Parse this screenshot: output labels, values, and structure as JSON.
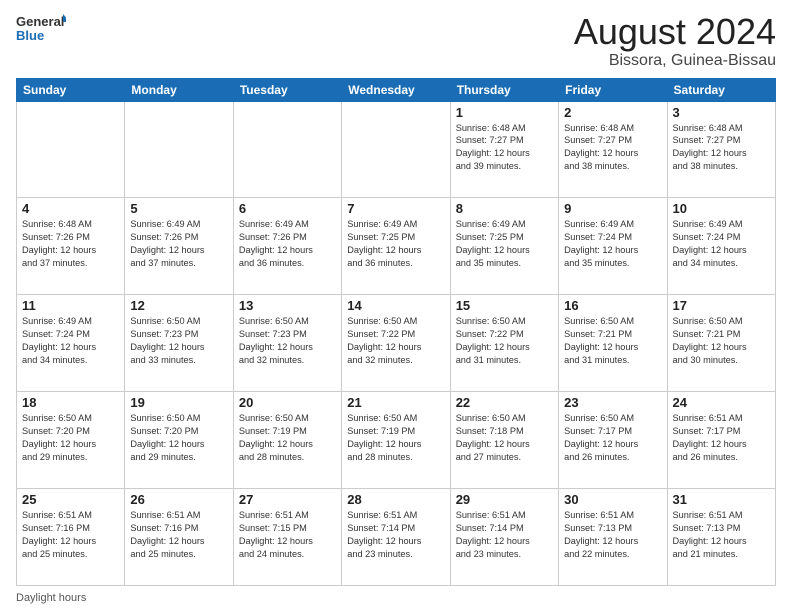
{
  "header": {
    "logo_general": "General",
    "logo_blue": "Blue",
    "title": "August 2024",
    "subtitle": "Bissora, Guinea-Bissau"
  },
  "footer": {
    "daylight_label": "Daylight hours"
  },
  "weekdays": [
    "Sunday",
    "Monday",
    "Tuesday",
    "Wednesday",
    "Thursday",
    "Friday",
    "Saturday"
  ],
  "weeks": [
    [
      {
        "day": "",
        "info": ""
      },
      {
        "day": "",
        "info": ""
      },
      {
        "day": "",
        "info": ""
      },
      {
        "day": "",
        "info": ""
      },
      {
        "day": "1",
        "info": "Sunrise: 6:48 AM\nSunset: 7:27 PM\nDaylight: 12 hours\nand 39 minutes."
      },
      {
        "day": "2",
        "info": "Sunrise: 6:48 AM\nSunset: 7:27 PM\nDaylight: 12 hours\nand 38 minutes."
      },
      {
        "day": "3",
        "info": "Sunrise: 6:48 AM\nSunset: 7:27 PM\nDaylight: 12 hours\nand 38 minutes."
      }
    ],
    [
      {
        "day": "4",
        "info": "Sunrise: 6:48 AM\nSunset: 7:26 PM\nDaylight: 12 hours\nand 37 minutes."
      },
      {
        "day": "5",
        "info": "Sunrise: 6:49 AM\nSunset: 7:26 PM\nDaylight: 12 hours\nand 37 minutes."
      },
      {
        "day": "6",
        "info": "Sunrise: 6:49 AM\nSunset: 7:26 PM\nDaylight: 12 hours\nand 36 minutes."
      },
      {
        "day": "7",
        "info": "Sunrise: 6:49 AM\nSunset: 7:25 PM\nDaylight: 12 hours\nand 36 minutes."
      },
      {
        "day": "8",
        "info": "Sunrise: 6:49 AM\nSunset: 7:25 PM\nDaylight: 12 hours\nand 35 minutes."
      },
      {
        "day": "9",
        "info": "Sunrise: 6:49 AM\nSunset: 7:24 PM\nDaylight: 12 hours\nand 35 minutes."
      },
      {
        "day": "10",
        "info": "Sunrise: 6:49 AM\nSunset: 7:24 PM\nDaylight: 12 hours\nand 34 minutes."
      }
    ],
    [
      {
        "day": "11",
        "info": "Sunrise: 6:49 AM\nSunset: 7:24 PM\nDaylight: 12 hours\nand 34 minutes."
      },
      {
        "day": "12",
        "info": "Sunrise: 6:50 AM\nSunset: 7:23 PM\nDaylight: 12 hours\nand 33 minutes."
      },
      {
        "day": "13",
        "info": "Sunrise: 6:50 AM\nSunset: 7:23 PM\nDaylight: 12 hours\nand 32 minutes."
      },
      {
        "day": "14",
        "info": "Sunrise: 6:50 AM\nSunset: 7:22 PM\nDaylight: 12 hours\nand 32 minutes."
      },
      {
        "day": "15",
        "info": "Sunrise: 6:50 AM\nSunset: 7:22 PM\nDaylight: 12 hours\nand 31 minutes."
      },
      {
        "day": "16",
        "info": "Sunrise: 6:50 AM\nSunset: 7:21 PM\nDaylight: 12 hours\nand 31 minutes."
      },
      {
        "day": "17",
        "info": "Sunrise: 6:50 AM\nSunset: 7:21 PM\nDaylight: 12 hours\nand 30 minutes."
      }
    ],
    [
      {
        "day": "18",
        "info": "Sunrise: 6:50 AM\nSunset: 7:20 PM\nDaylight: 12 hours\nand 29 minutes."
      },
      {
        "day": "19",
        "info": "Sunrise: 6:50 AM\nSunset: 7:20 PM\nDaylight: 12 hours\nand 29 minutes."
      },
      {
        "day": "20",
        "info": "Sunrise: 6:50 AM\nSunset: 7:19 PM\nDaylight: 12 hours\nand 28 minutes."
      },
      {
        "day": "21",
        "info": "Sunrise: 6:50 AM\nSunset: 7:19 PM\nDaylight: 12 hours\nand 28 minutes."
      },
      {
        "day": "22",
        "info": "Sunrise: 6:50 AM\nSunset: 7:18 PM\nDaylight: 12 hours\nand 27 minutes."
      },
      {
        "day": "23",
        "info": "Sunrise: 6:50 AM\nSunset: 7:17 PM\nDaylight: 12 hours\nand 26 minutes."
      },
      {
        "day": "24",
        "info": "Sunrise: 6:51 AM\nSunset: 7:17 PM\nDaylight: 12 hours\nand 26 minutes."
      }
    ],
    [
      {
        "day": "25",
        "info": "Sunrise: 6:51 AM\nSunset: 7:16 PM\nDaylight: 12 hours\nand 25 minutes."
      },
      {
        "day": "26",
        "info": "Sunrise: 6:51 AM\nSunset: 7:16 PM\nDaylight: 12 hours\nand 25 minutes."
      },
      {
        "day": "27",
        "info": "Sunrise: 6:51 AM\nSunset: 7:15 PM\nDaylight: 12 hours\nand 24 minutes."
      },
      {
        "day": "28",
        "info": "Sunrise: 6:51 AM\nSunset: 7:14 PM\nDaylight: 12 hours\nand 23 minutes."
      },
      {
        "day": "29",
        "info": "Sunrise: 6:51 AM\nSunset: 7:14 PM\nDaylight: 12 hours\nand 23 minutes."
      },
      {
        "day": "30",
        "info": "Sunrise: 6:51 AM\nSunset: 7:13 PM\nDaylight: 12 hours\nand 22 minutes."
      },
      {
        "day": "31",
        "info": "Sunrise: 6:51 AM\nSunset: 7:13 PM\nDaylight: 12 hours\nand 21 minutes."
      }
    ]
  ]
}
